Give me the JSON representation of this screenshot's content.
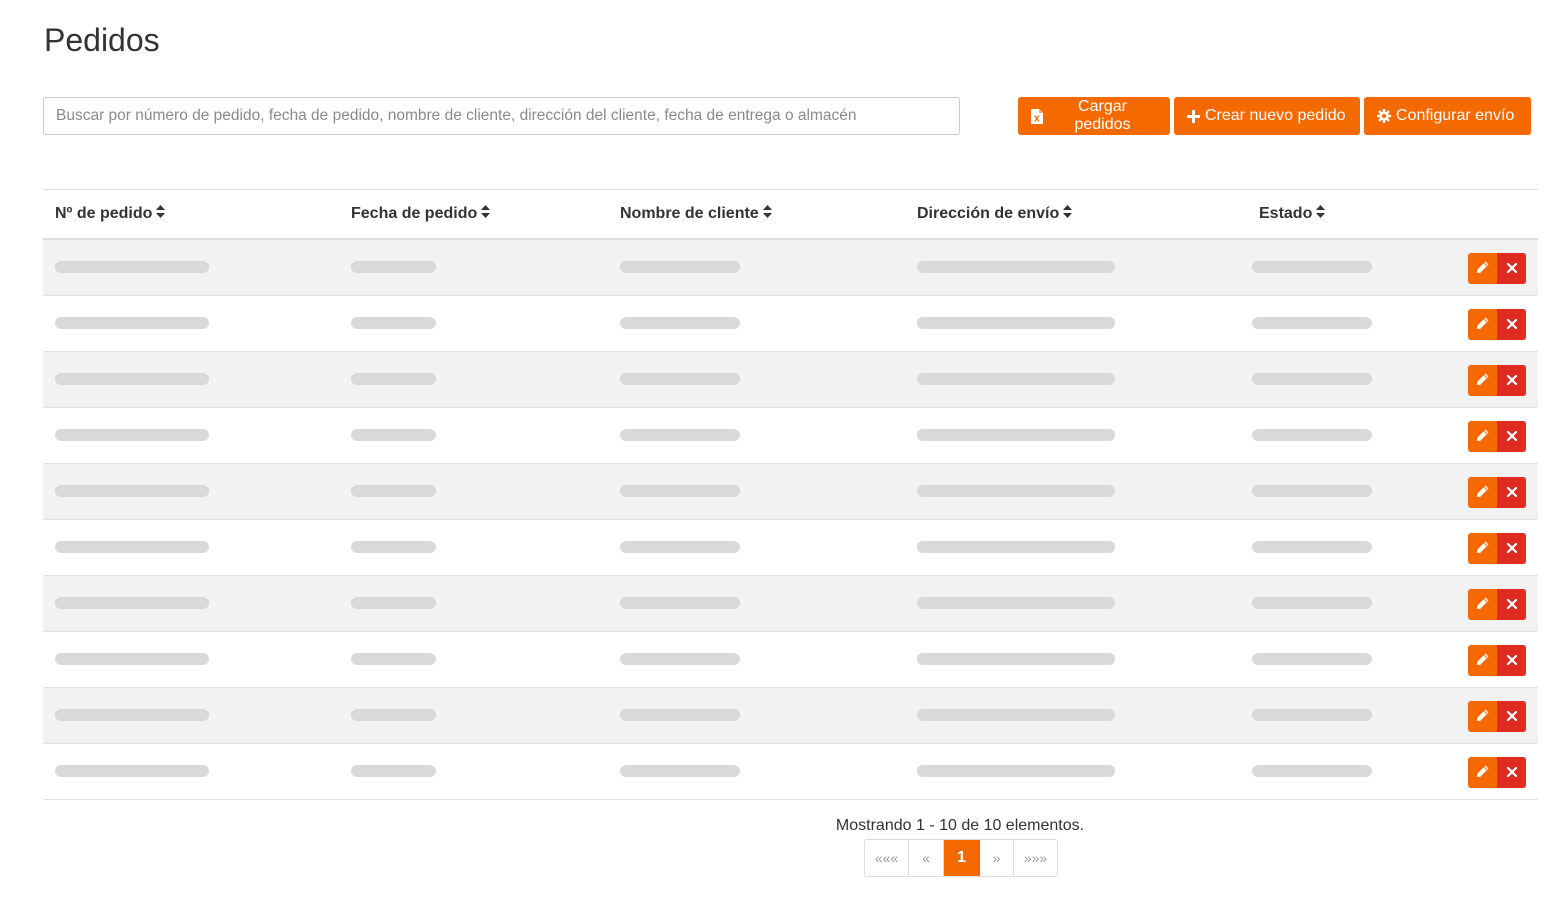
{
  "page": {
    "title": "Pedidos"
  },
  "search": {
    "placeholder": "Buscar por número de pedido, fecha de pedido, nombre de cliente, dirección del cliente, fecha de entrega o almacén",
    "value": ""
  },
  "toolbar": {
    "upload_label": "Cargar pedidos",
    "create_label": "Crear nuevo pedido",
    "config_label": "Configurar envío"
  },
  "table": {
    "columns": [
      {
        "label": "Nº de pedido"
      },
      {
        "label": "Fecha de pedido"
      },
      {
        "label": "Nombre de cliente"
      },
      {
        "label": "Dirección de envío"
      },
      {
        "label": "Estado"
      }
    ],
    "row_count": 10,
    "rows_loading": true
  },
  "summary": {
    "text": "Mostrando 1 - 10 de 10 elementos."
  },
  "pagination": {
    "first": "«««",
    "prev": "«",
    "current": "1",
    "next": "»",
    "last": "»»»"
  },
  "colors": {
    "accent": "#f56a00",
    "danger": "#e02b20",
    "row_stripe": "#f2f2f2",
    "skeleton": "#d9d9d9"
  },
  "icons": {
    "upload": "file-excel-icon",
    "create": "plus-icon",
    "config": "gear-icon",
    "sort": "sort-icon",
    "edit": "pencil-icon",
    "delete": "close-icon"
  }
}
